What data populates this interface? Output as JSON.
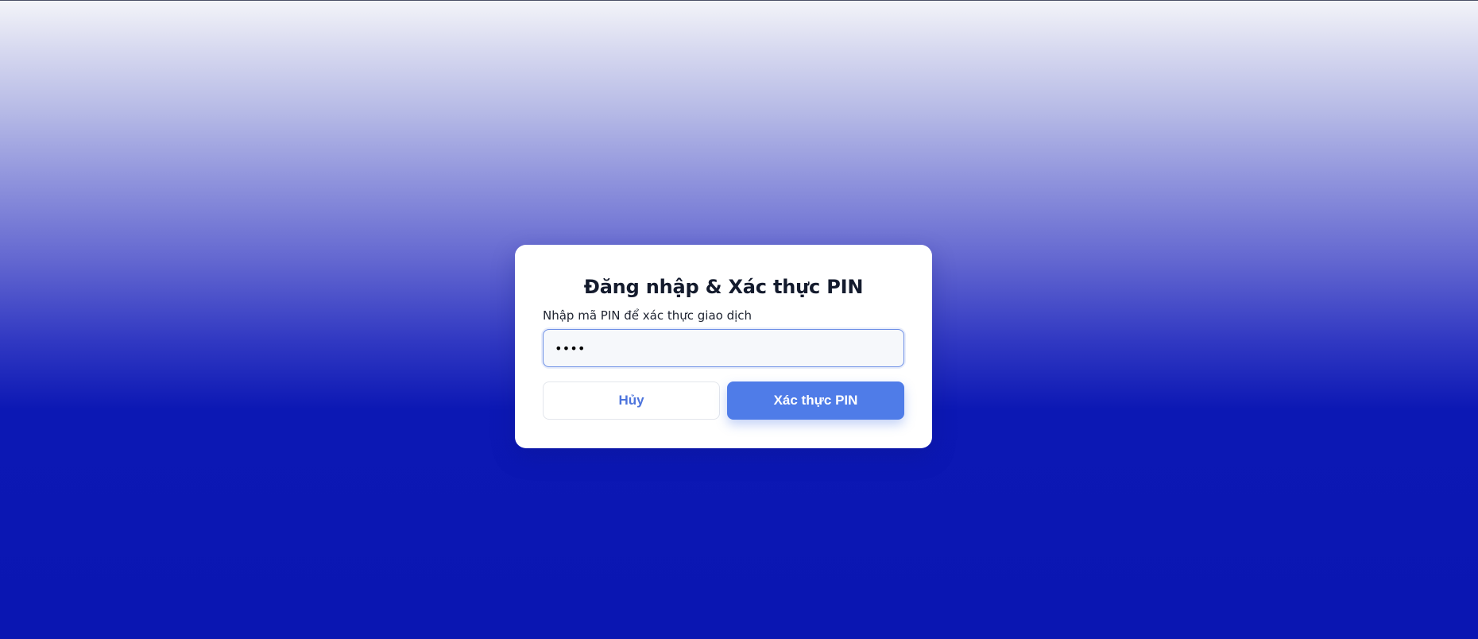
{
  "dialog": {
    "title": "Đăng nhập & Xác thực PIN",
    "pin_label": "Nhập mã PIN để xác thực giao dịch",
    "pin_value": "1234",
    "cancel_label": "Hủy",
    "submit_label": "Xác thực PIN"
  },
  "colors": {
    "background_top": "#f3f4f9",
    "background_bottom": "#0a16b2",
    "primary": "#4f7ce8",
    "cancel_text": "#4d74dc",
    "input_border": "#6d8fe6"
  }
}
